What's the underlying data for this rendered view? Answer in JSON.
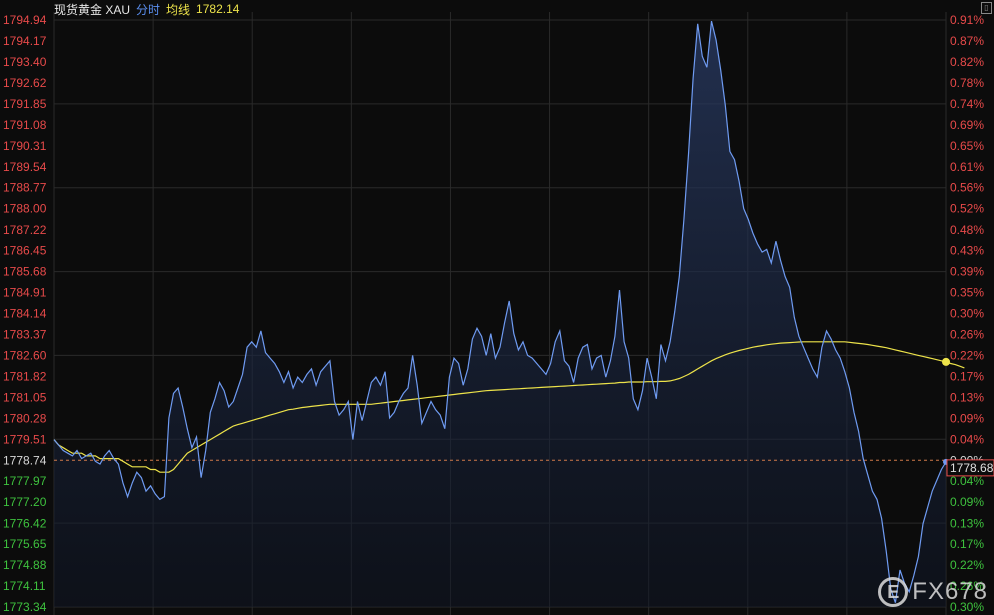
{
  "header": {
    "title": "现货黄金 XAU",
    "mode_label": "分时",
    "avg_label": "均线",
    "avg_value": "1782.14"
  },
  "watermark": {
    "text": "FX678"
  },
  "colors": {
    "background": "#0c0c0c",
    "price_line": "#6f9bf2",
    "avg_line": "#ede34a",
    "up_label": "#e84a4a",
    "down_label": "#3ec23e",
    "grid": "#2a2a2a",
    "baseline": "#d07a4a"
  },
  "chart_data": {
    "type": "line",
    "title": "",
    "ylim": [
      1773.34,
      1794.94
    ],
    "baseline": 1778.74,
    "current_price": "1778.68",
    "grid": true,
    "y_ticks": [
      "1794.94",
      "1794.17",
      "1793.40",
      "1792.62",
      "1791.85",
      "1791.08",
      "1790.31",
      "1789.54",
      "1788.77",
      "1788.00",
      "1787.22",
      "1786.45",
      "1785.68",
      "1784.91",
      "1784.14",
      "1783.37",
      "1782.60",
      "1781.82",
      "1781.05",
      "1780.28",
      "1779.51",
      "1778.74",
      "1777.97",
      "1777.20",
      "1776.42",
      "1775.65",
      "1774.88",
      "1774.11",
      "1773.34"
    ],
    "pct_ticks": [
      "0.91%",
      "0.87%",
      "0.82%",
      "0.78%",
      "0.74%",
      "0.69%",
      "0.65%",
      "0.61%",
      "0.56%",
      "0.52%",
      "0.48%",
      "0.43%",
      "0.39%",
      "0.35%",
      "0.30%",
      "0.26%",
      "0.22%",
      "0.17%",
      "0.13%",
      "0.09%",
      "0.04%",
      "0.00%",
      "0.04%",
      "0.09%",
      "0.13%",
      "0.17%",
      "0.22%",
      "0.26%",
      "0.30%"
    ],
    "series": [
      {
        "values": [
          1779.5,
          1779.3,
          1779.1,
          1779.0,
          1778.9,
          1779.1,
          1778.8,
          1778.9,
          1779.0,
          1778.7,
          1778.6,
          1778.9,
          1779.1,
          1778.8,
          1778.6,
          1777.9,
          1777.4,
          1777.9,
          1778.3,
          1778.1,
          1777.6,
          1777.8,
          1777.5,
          1777.3,
          1777.4,
          1780.3,
          1781.2,
          1781.4,
          1780.7,
          1779.9,
          1779.2,
          1779.6,
          1778.1,
          1779.1,
          1780.5,
          1781.0,
          1781.6,
          1781.3,
          1780.7,
          1780.9,
          1781.4,
          1781.9,
          1782.9,
          1783.1,
          1782.9,
          1783.5,
          1782.7,
          1782.5,
          1782.3,
          1782.0,
          1781.6,
          1782.0,
          1781.4,
          1781.8,
          1781.6,
          1781.9,
          1782.1,
          1781.5,
          1782.0,
          1782.2,
          1782.4,
          1780.9,
          1780.4,
          1780.6,
          1780.9,
          1779.5,
          1780.9,
          1780.2,
          1780.9,
          1781.6,
          1781.8,
          1781.5,
          1782.0,
          1780.3,
          1780.5,
          1780.9,
          1781.2,
          1781.4,
          1782.6,
          1781.5,
          1780.1,
          1780.5,
          1780.9,
          1780.6,
          1780.4,
          1779.9,
          1781.8,
          1782.5,
          1782.3,
          1781.5,
          1782.1,
          1783.2,
          1783.6,
          1783.3,
          1782.6,
          1783.4,
          1782.5,
          1782.9,
          1783.8,
          1784.6,
          1783.4,
          1782.8,
          1783.1,
          1782.6,
          1782.5,
          1782.3,
          1782.1,
          1781.9,
          1782.3,
          1783.1,
          1783.5,
          1782.4,
          1782.2,
          1781.6,
          1782.5,
          1782.9,
          1783.0,
          1782.1,
          1782.5,
          1782.6,
          1781.8,
          1782.4,
          1783.3,
          1785.0,
          1783.1,
          1782.5,
          1781.0,
          1780.6,
          1781.3,
          1782.5,
          1781.8,
          1781.0,
          1783.0,
          1782.4,
          1783.1,
          1784.2,
          1785.5,
          1787.6,
          1790.0,
          1792.8,
          1794.8,
          1793.6,
          1793.2,
          1794.9,
          1794.2,
          1793.1,
          1791.8,
          1790.1,
          1789.8,
          1789.0,
          1788.0,
          1787.6,
          1787.1,
          1786.7,
          1786.4,
          1786.5,
          1786.0,
          1786.8,
          1786.1,
          1785.5,
          1785.1,
          1784.0,
          1783.3,
          1782.9,
          1782.5,
          1782.1,
          1781.8,
          1782.9,
          1783.5,
          1783.2,
          1782.8,
          1782.5,
          1782.0,
          1781.4,
          1780.5,
          1779.8,
          1778.8,
          1778.2,
          1777.6,
          1777.3,
          1776.6,
          1775.4,
          1774.0,
          1773.5,
          1774.7,
          1774.2,
          1773.9,
          1774.5,
          1775.2,
          1776.4,
          1777.0,
          1777.6,
          1778.0,
          1778.4,
          1778.68
        ]
      },
      {
        "values": [
          1779.5,
          1779.3,
          1779.2,
          1779.1,
          1779.0,
          1779.0,
          1779.0,
          1778.9,
          1778.9,
          1778.9,
          1778.8,
          1778.8,
          1778.8,
          1778.8,
          1778.8,
          1778.7,
          1778.6,
          1778.5,
          1778.5,
          1778.5,
          1778.5,
          1778.4,
          1778.4,
          1778.3,
          1778.3,
          1778.3,
          1778.4,
          1778.6,
          1778.8,
          1779.0,
          1779.1,
          1779.2,
          1779.3,
          1779.4,
          1779.5,
          1779.6,
          1779.7,
          1779.8,
          1779.9,
          1780.0,
          1780.05,
          1780.1,
          1780.15,
          1780.2,
          1780.25,
          1780.3,
          1780.35,
          1780.4,
          1780.45,
          1780.5,
          1780.55,
          1780.6,
          1780.62,
          1780.65,
          1780.68,
          1780.7,
          1780.72,
          1780.74,
          1780.76,
          1780.78,
          1780.8,
          1780.8,
          1780.8,
          1780.8,
          1780.8,
          1780.8,
          1780.8,
          1780.8,
          1780.8,
          1780.8,
          1780.82,
          1780.84,
          1780.86,
          1780.88,
          1780.9,
          1780.92,
          1780.94,
          1780.96,
          1780.98,
          1781.0,
          1781.02,
          1781.04,
          1781.06,
          1781.08,
          1781.1,
          1781.12,
          1781.14,
          1781.16,
          1781.18,
          1781.2,
          1781.22,
          1781.24,
          1781.26,
          1781.28,
          1781.3,
          1781.31,
          1781.32,
          1781.33,
          1781.34,
          1781.35,
          1781.36,
          1781.37,
          1781.38,
          1781.39,
          1781.4,
          1781.41,
          1781.42,
          1781.43,
          1781.44,
          1781.45,
          1781.46,
          1781.47,
          1781.48,
          1781.49,
          1781.5,
          1781.51,
          1781.52,
          1781.53,
          1781.54,
          1781.55,
          1781.56,
          1781.57,
          1781.58,
          1781.6,
          1781.6,
          1781.62,
          1781.62,
          1781.62,
          1781.62,
          1781.63,
          1781.63,
          1781.63,
          1781.64,
          1781.64,
          1781.66,
          1781.7,
          1781.75,
          1781.82,
          1781.9,
          1782.0,
          1782.1,
          1782.2,
          1782.3,
          1782.4,
          1782.48,
          1782.55,
          1782.62,
          1782.68,
          1782.73,
          1782.78,
          1782.82,
          1782.86,
          1782.9,
          1782.93,
          1782.96,
          1782.99,
          1783.01,
          1783.03,
          1783.05,
          1783.06,
          1783.07,
          1783.08,
          1783.09,
          1783.1,
          1783.1,
          1783.1,
          1783.1,
          1783.1,
          1783.1,
          1783.1,
          1783.1,
          1783.1,
          1783.1,
          1783.08,
          1783.06,
          1783.04,
          1783.02,
          1783.0,
          1782.97,
          1782.94,
          1782.91,
          1782.88,
          1782.84,
          1782.8,
          1782.76,
          1782.72,
          1782.68,
          1782.64,
          1782.6,
          1782.56,
          1782.52,
          1782.48,
          1782.44,
          1782.4,
          1782.36,
          1782.3,
          1782.26,
          1782.2,
          1782.14
        ]
      }
    ]
  }
}
